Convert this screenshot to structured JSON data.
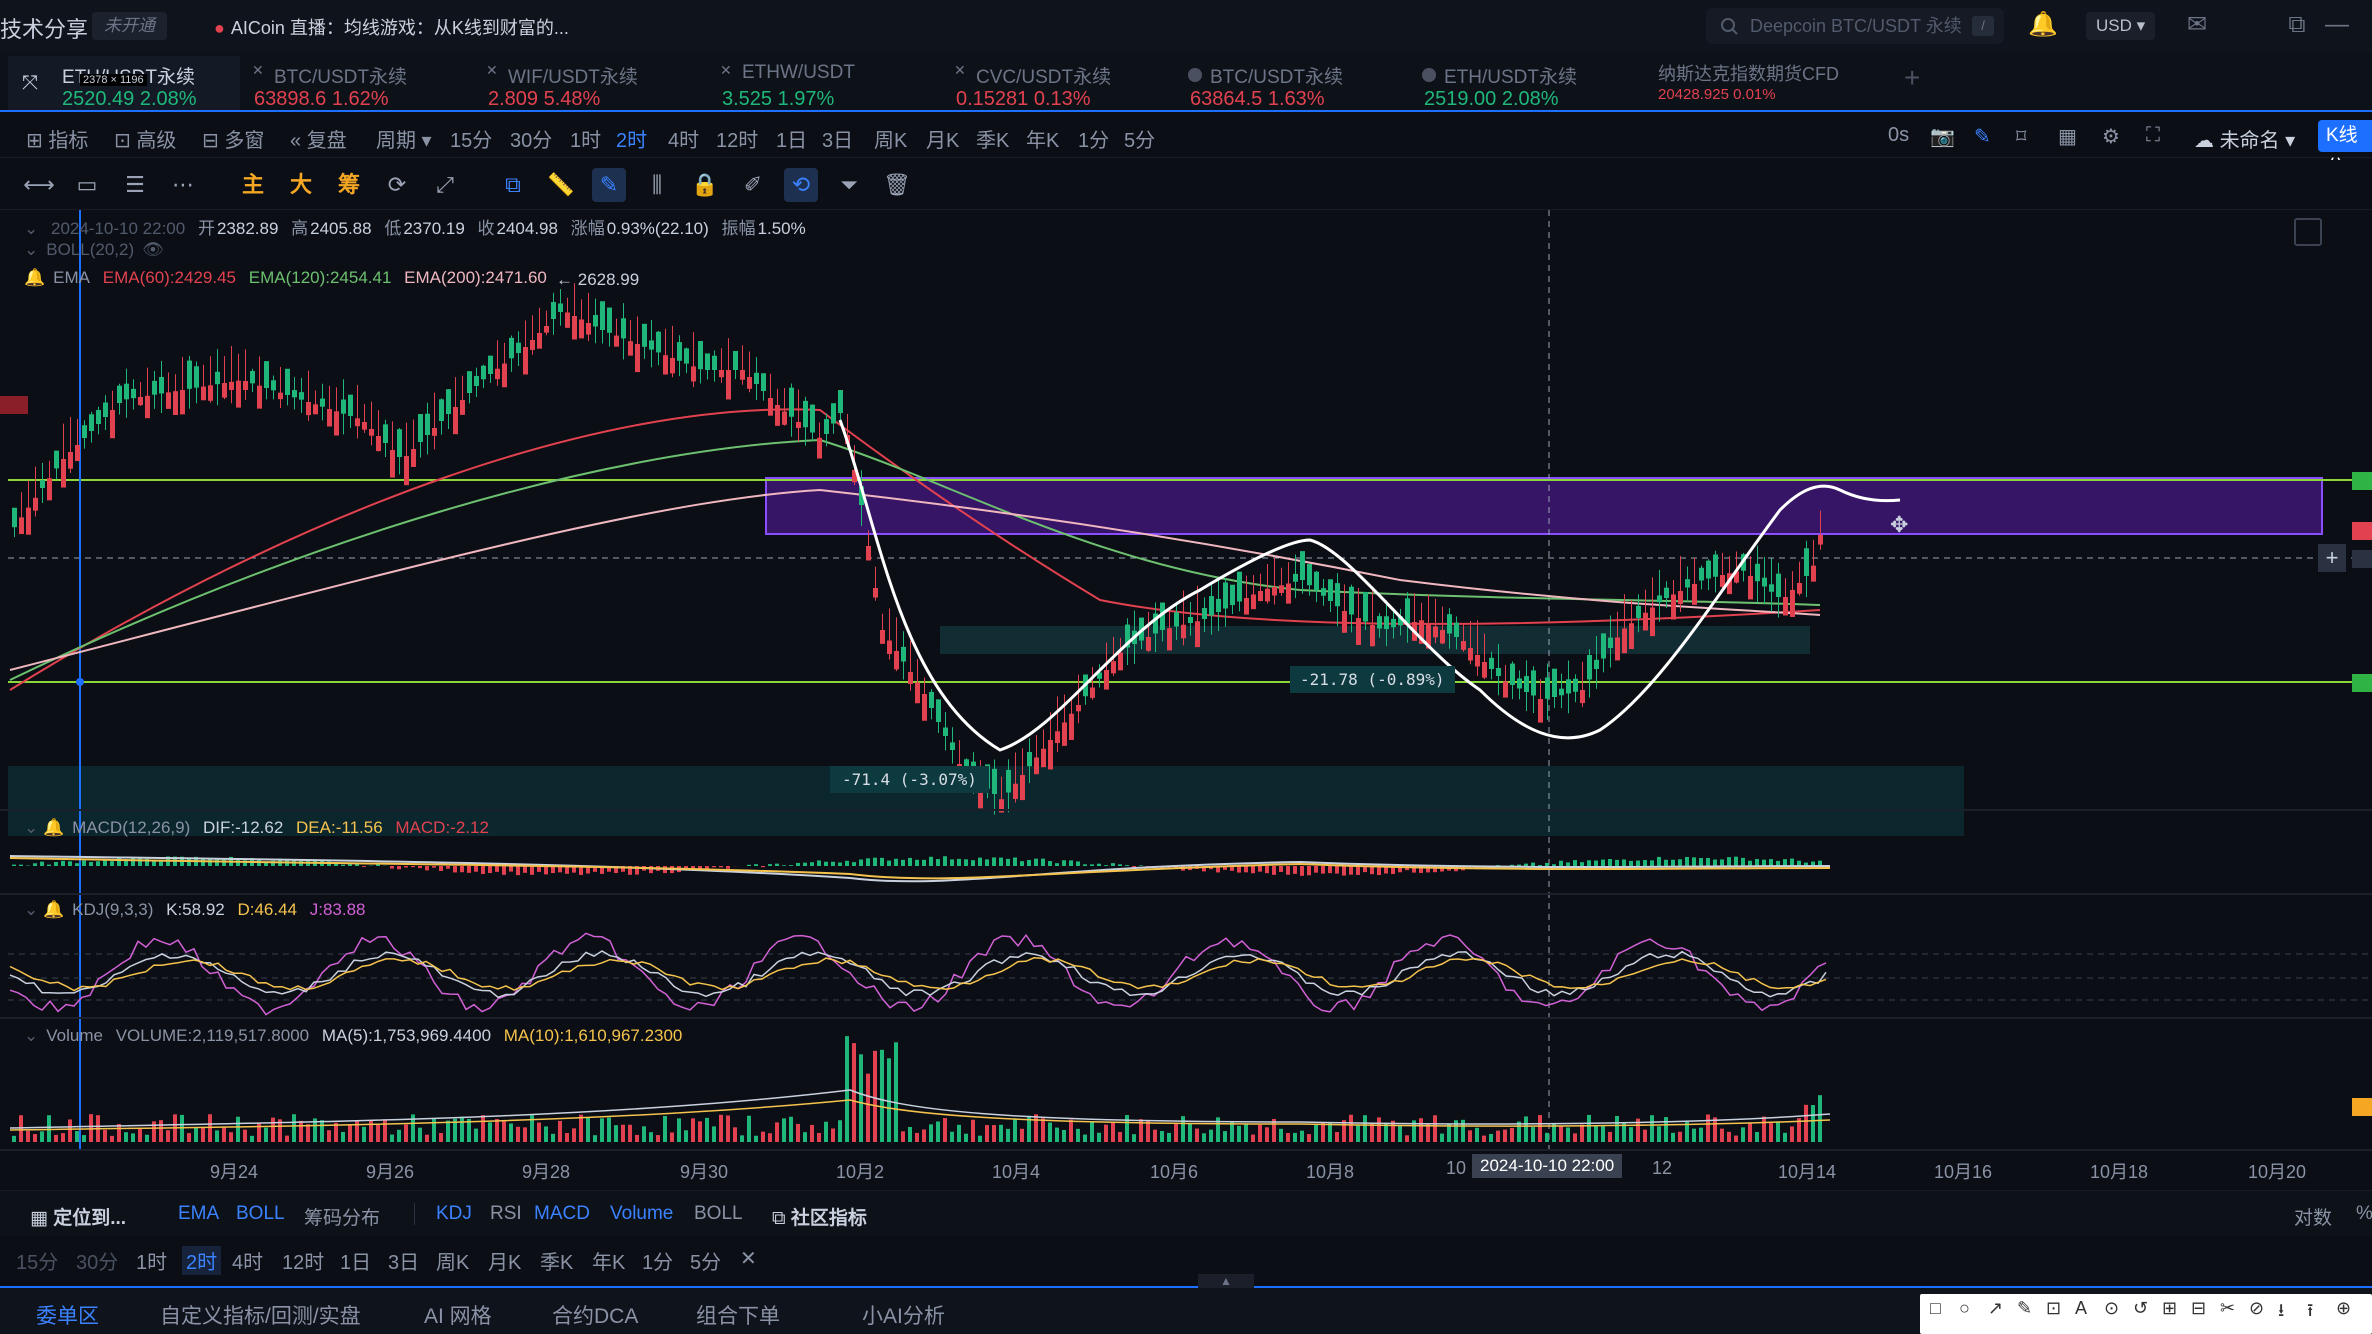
{
  "topbar": {
    "brand": "技术分享",
    "badge": "未开通",
    "live_text": "AICoin 直播：均线游戏：从K线到财富的...",
    "search_placeholder": "Deepcoin BTC/USDT 永续",
    "search_key": "/",
    "currency": "USD ▾",
    "icons": [
      "search-icon",
      "bell-icon",
      "mail-icon",
      "layout-icon",
      "minimize-icon"
    ]
  },
  "tabs": [
    {
      "name": "ETH/USDT永续",
      "price": "2520.49",
      "change": "2.08%",
      "dir": "up",
      "size_note": "2378 × 1196"
    },
    {
      "name": "BTC/USDT永续",
      "price": "63898.6",
      "change": "1.62%",
      "dir": "down"
    },
    {
      "name": "WIF/USDT永续",
      "price": "2.809",
      "change": "5.48%",
      "dir": "down"
    },
    {
      "name": "ETHW/USDT",
      "price": "3.525",
      "change": "1.97%",
      "dir": "up"
    },
    {
      "name": "CVC/USDT永续",
      "price": "0.15281",
      "change": "0.13%",
      "dir": "down"
    },
    {
      "name": "BTC/USDT永续",
      "price": "63864.5",
      "change": "1.63%",
      "dir": "down"
    },
    {
      "name": "ETH/USDT永续",
      "price": "2519.00",
      "change": "2.08%",
      "dir": "up"
    },
    {
      "name": "纳斯达克指数期货CFD",
      "price": "20428.925",
      "change": "0.01%",
      "dir": "down"
    }
  ],
  "tfbar": {
    "left_items": [
      "指标",
      "高级",
      "多窗",
      "复盘",
      "周期 ▾"
    ],
    "periods": [
      "15分",
      "30分",
      "1时",
      "2时",
      "4时",
      "12时",
      "1日",
      "3日",
      "周K",
      "月K",
      "季K",
      "年K",
      "1分",
      "5分"
    ],
    "active_period": "2时",
    "right_items": {
      "zero_s": "0s",
      "layout_name": "未命名 ▾",
      "kline": "K线分"
    }
  },
  "drawbar": {
    "orange_tools": [
      "主",
      "大",
      "筹"
    ]
  },
  "legend": {
    "ohlc": {
      "time": "2024-10-10 22:00",
      "open_label": "开",
      "open": "2382.89",
      "high_label": "高",
      "high": "2405.88",
      "low_label": "低",
      "low": "2370.19",
      "close_label": "收",
      "close": "2404.98",
      "chg_label": "涨幅",
      "chg": "0.93%(22.10)",
      "amp_label": "振幅",
      "amp": "1.50%"
    },
    "boll": "BOLL(20,2)",
    "ema": {
      "label": "EMA",
      "ema60": "EMA(60):2429.45",
      "ema120": "EMA(120):2454.41",
      "ema200": "EMA(200):2471.60"
    },
    "high_mark": "2628.99"
  },
  "annotations": {
    "measure1": "-21.78 (-0.89%)",
    "measure2": "-71.4 (-3.07%)"
  },
  "macd": {
    "label": "MACD(12,26,9)",
    "dif": "DIF:-12.62",
    "dea": "DEA:-11.56",
    "macd": "MACD:-2.12"
  },
  "kdj": {
    "label": "KDJ(9,3,3)",
    "k": "K:58.92",
    "d": "D:46.44",
    "j": "J:83.88"
  },
  "volume": {
    "label": "Volume",
    "vol": "VOLUME:2,119,517.8000",
    "ma5": "MA(5):1,753,969.4400",
    "ma10": "MA(10):1,610,967.2300"
  },
  "xaxis": {
    "labels": [
      "9月24",
      "9月26",
      "9月28",
      "9月30",
      "10月2",
      "10月4",
      "10月6",
      "10月8",
      "10",
      "12",
      "10月14",
      "10月16",
      "10月18",
      "10月20"
    ],
    "crosshair_label": "2024-10-10 22:00"
  },
  "indbar": {
    "locate": "定位到...",
    "left": [
      "EMA",
      "BOLL",
      "筹码分布"
    ],
    "right": [
      "KDJ",
      "RSI",
      "MACD",
      "Volume",
      "BOLL"
    ],
    "community": "社区指标",
    "duishu": "对数",
    "pct": "%"
  },
  "tfbar2": [
    "15分",
    "30分",
    "1时",
    "2时",
    "4时",
    "12时",
    "1日",
    "3日",
    "周K",
    "月K",
    "季K",
    "年K",
    "1分",
    "5分",
    "✕"
  ],
  "tfbar2_active": "2时",
  "footer": [
    "委单区",
    "自定义指标/回测/实盘",
    "AI 网格",
    "合约DCA",
    "组合下单",
    "小AI分析"
  ],
  "footer_active": "委单区",
  "colors": {
    "up": "#1fb87a",
    "down": "#e2424f",
    "accent": "#3b82ff",
    "zone": "#6a1fc9",
    "hline": "#8cd53a"
  },
  "chart_data": {
    "type": "candlestick",
    "ema_colors": {
      "ema60": "#e2424f",
      "ema120": "#6cc070",
      "ema200": "#f0b7c0"
    }
  }
}
